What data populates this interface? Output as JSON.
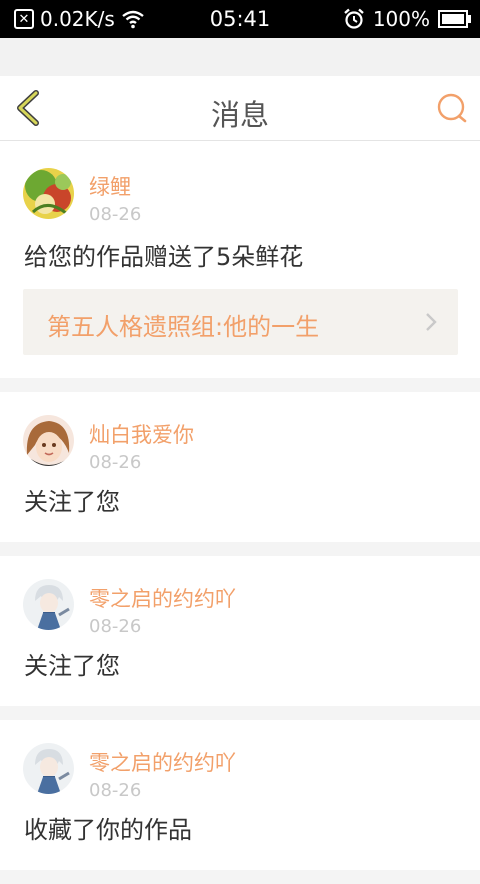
{
  "status_bar": {
    "network_speed": "0.02K/s",
    "time": "05:41",
    "battery": "100%",
    "battery_level": 1.0,
    "icons": [
      "close-box-icon",
      "wifi-icon",
      "alarm-icon",
      "battery-icon"
    ]
  },
  "header": {
    "title": "消息",
    "back_icon": "chevron-left-icon",
    "search_icon": "search-icon"
  },
  "colors": {
    "accent": "#f2a06a",
    "back": "#9b9b3a",
    "text": "#333333",
    "muted": "#c8c8c8"
  },
  "messages": [
    {
      "username": "绿鲤",
      "date": "08-26",
      "text": "给您的作品赠送了5朵鲜花",
      "work_title": "第五人格遗照组:他的一生",
      "avatar": "avatar-green-girl"
    },
    {
      "username": "灿白我爱你",
      "date": "08-26",
      "text": "关注了您",
      "avatar": "avatar-brown-hair-girl"
    },
    {
      "username": "零之启的约约吖",
      "date": "08-26",
      "text": "关注了您",
      "avatar": "avatar-white-hair-boy"
    },
    {
      "username": "零之启的约约吖",
      "date": "08-26",
      "text": "收藏了你的作品",
      "avatar": "avatar-white-hair-boy"
    }
  ]
}
